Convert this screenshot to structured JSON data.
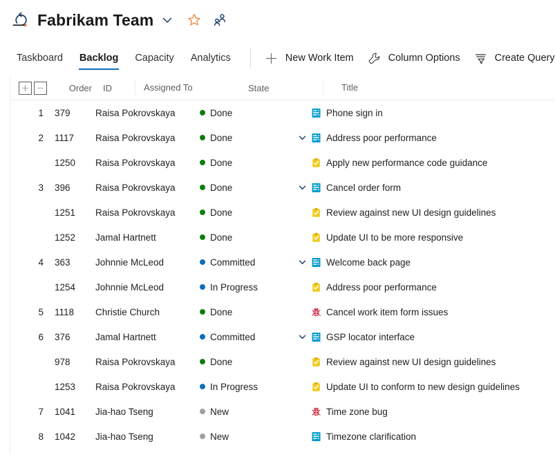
{
  "header": {
    "sprint_icon": "sprint-iteration-icon",
    "title": "Fabrikam Team",
    "chevron_icon": "chevron-down-icon",
    "favorite_icon": "star-outline-icon",
    "team_icon": "people-team-icon"
  },
  "tabs": [
    {
      "label": "Taskboard",
      "active": false
    },
    {
      "label": "Backlog",
      "active": true
    },
    {
      "label": "Capacity",
      "active": false
    },
    {
      "label": "Analytics",
      "active": false
    }
  ],
  "commands": [
    {
      "label": "New Work Item",
      "icon": "plus-icon"
    },
    {
      "label": "Column Options",
      "icon": "wrench-icon"
    },
    {
      "label": "Create Query",
      "icon": "filter-icon"
    }
  ],
  "grid": {
    "expand_all_label": "+",
    "collapse_all_label": "−",
    "columns": [
      "Order",
      "ID",
      "Assigned To",
      "State",
      "Title"
    ],
    "rows": [
      {
        "order": "1",
        "id": "379",
        "assigned_to": "Raisa Pokrovskaya",
        "state": "Done",
        "state_color": "#107c10",
        "title": "Phone sign in",
        "type": "pbi",
        "child": false,
        "expanded": false,
        "has_chevron": false
      },
      {
        "order": "2",
        "id": "1117",
        "assigned_to": "Raisa Pokrovskaya",
        "state": "Done",
        "state_color": "#107c10",
        "title": "Address poor performance",
        "type": "pbi",
        "child": false,
        "expanded": true,
        "has_chevron": true
      },
      {
        "order": "",
        "id": "1250",
        "assigned_to": "Raisa Pokrovskaya",
        "state": "Done",
        "state_color": "#107c10",
        "title": "Apply new performance code guidance",
        "type": "task",
        "child": true,
        "expanded": false,
        "has_chevron": false
      },
      {
        "order": "3",
        "id": "396",
        "assigned_to": "Raisa Pokrovskaya",
        "state": "Done",
        "state_color": "#107c10",
        "title": "Cancel order form",
        "type": "pbi",
        "child": false,
        "expanded": true,
        "has_chevron": true
      },
      {
        "order": "",
        "id": "1251",
        "assigned_to": "Raisa Pokrovskaya",
        "state": "Done",
        "state_color": "#107c10",
        "title": "Review against new UI design guidelines",
        "type": "task",
        "child": true,
        "expanded": false,
        "has_chevron": false
      },
      {
        "order": "",
        "id": "1252",
        "assigned_to": "Jamal Hartnett",
        "state": "Done",
        "state_color": "#107c10",
        "title": "Update UI to be more responsive",
        "type": "task",
        "child": true,
        "expanded": false,
        "has_chevron": false
      },
      {
        "order": "4",
        "id": "363",
        "assigned_to": "Johnnie McLeod",
        "state": "Committed",
        "state_color": "#0f6cbd",
        "title": "Welcome back page",
        "type": "pbi",
        "child": false,
        "expanded": true,
        "has_chevron": true
      },
      {
        "order": "",
        "id": "1254",
        "assigned_to": "Johnnie McLeod",
        "state": "In Progress",
        "state_color": "#0f6cbd",
        "title": "Address poor performance",
        "type": "task",
        "child": true,
        "expanded": false,
        "has_chevron": false
      },
      {
        "order": "5",
        "id": "1118",
        "assigned_to": "Christie Church",
        "state": "Done",
        "state_color": "#107c10",
        "title": "Cancel work item form issues",
        "type": "bug",
        "child": false,
        "expanded": false,
        "has_chevron": false
      },
      {
        "order": "6",
        "id": "376",
        "assigned_to": "Jamal Hartnett",
        "state": "Committed",
        "state_color": "#0f6cbd",
        "title": "GSP locator interface",
        "type": "pbi",
        "child": false,
        "expanded": true,
        "has_chevron": true
      },
      {
        "order": "",
        "id": "978",
        "assigned_to": "Raisa Pokrovskaya",
        "state": "Done",
        "state_color": "#107c10",
        "title": "Review against new UI design guidelines",
        "type": "task",
        "child": true,
        "expanded": false,
        "has_chevron": false
      },
      {
        "order": "",
        "id": "1253",
        "assigned_to": "Raisa Pokrovskaya",
        "state": "In Progress",
        "state_color": "#0f6cbd",
        "title": "Update UI to conform to new design guidelines",
        "type": "task",
        "child": true,
        "expanded": false,
        "has_chevron": false
      },
      {
        "order": "7",
        "id": "1041",
        "assigned_to": "Jia-hao Tseng",
        "state": "New",
        "state_color": "#a19f9d",
        "title": "Time zone bug",
        "type": "bug",
        "child": false,
        "expanded": false,
        "has_chevron": false
      },
      {
        "order": "8",
        "id": "1042",
        "assigned_to": "Jia-hao Tseng",
        "state": "New",
        "state_color": "#a19f9d",
        "title": "Timezone clarification",
        "type": "pbi",
        "child": false,
        "expanded": false,
        "has_chevron": false
      }
    ]
  },
  "colors": {
    "accent": "#0f6cbd",
    "done": "#107c10",
    "new": "#a19f9d",
    "pbi_icon": "#009ccc",
    "task_icon": "#f2cb1d",
    "bug_icon": "#cc293d",
    "star": "#e8833a"
  }
}
